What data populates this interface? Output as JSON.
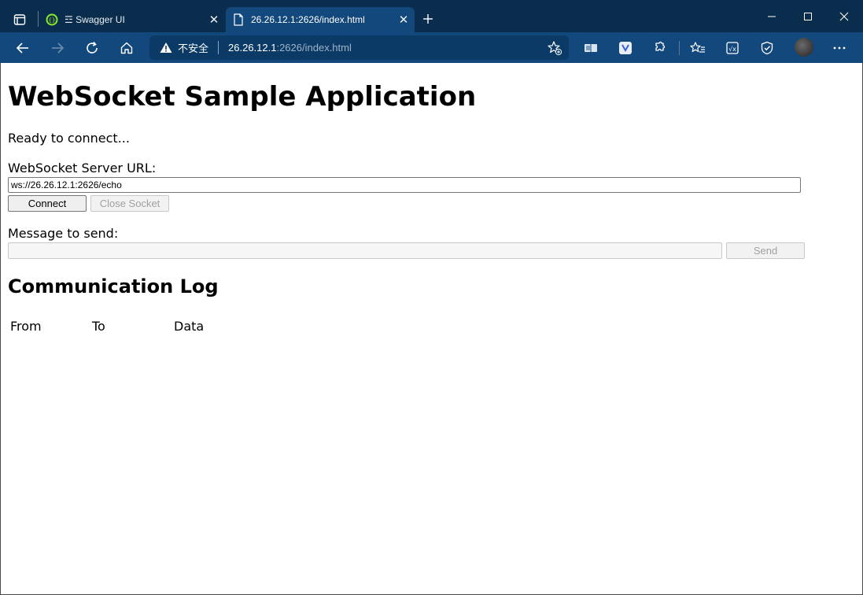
{
  "browser": {
    "tabs": [
      {
        "title": "☲ Swagger UI",
        "close": "✕"
      },
      {
        "title": "26.26.12.1:2626/index.html",
        "close": "✕"
      }
    ],
    "new_tab_label": "+",
    "address": {
      "security_label": "不安全",
      "url_host": "26.26.12.1",
      "url_rest": ":2626/index.html"
    },
    "colors": {
      "tabstrip": "#0b2d4d",
      "toolbar": "#12487c",
      "omnibox": "#0b3a66"
    }
  },
  "page": {
    "title": "WebSocket Sample Application",
    "status": "Ready to connect...",
    "server_url_label": "WebSocket Server URL:",
    "server_url_value": "ws://26.26.12.1:2626/echo",
    "connect_label": "Connect",
    "close_socket_label": "Close Socket",
    "message_label": "Message to send:",
    "message_value": "",
    "send_label": "Send",
    "log_title": "Communication Log",
    "log_columns": [
      "From",
      "To",
      "Data"
    ]
  }
}
